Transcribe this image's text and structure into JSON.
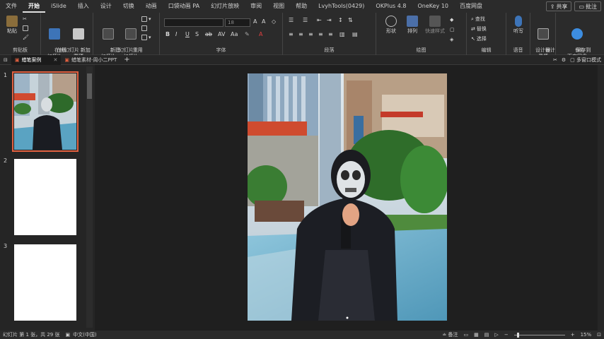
{
  "menu": {
    "tabs": [
      "文件",
      "开始",
      "iSlide",
      "插入",
      "设计",
      "切换",
      "动画",
      "口袋动画 PA",
      "幻灯片放映",
      "审阅",
      "视图",
      "帮助",
      "LvyhTools(0429)",
      "OKPlus 4.8",
      "OneKey 10",
      "百度网盘"
    ],
    "share_label": "共享",
    "comment_label": "批注"
  },
  "ribbon": {
    "clipboard": {
      "paste": "粘贴",
      "group": "剪贴板"
    },
    "online_slides": {
      "btn1": "在线\n幻灯片",
      "btn2": "新加\n载项",
      "group": "在线幻灯片"
    },
    "slides": {
      "new_slide": "新建\n幻灯片",
      "reuse_slide": "重用\n幻灯片",
      "group": "幻灯片"
    },
    "font": {
      "font_size": "18",
      "group": "字体"
    },
    "paragraph": {
      "group": "段落"
    },
    "drawing": {
      "shape": "形状",
      "arrange": "排列",
      "quick_style": "快速样式",
      "group": "绘图"
    },
    "editing": {
      "find": "查找",
      "replace": "替换",
      "select": "选择",
      "group": "编辑"
    },
    "voice": {
      "dictate": "听写",
      "group": "语音"
    },
    "designer": {
      "ideas": "设计\n灵感",
      "group": "设计器"
    },
    "save": {
      "baidu": "保存到\n百度网盘",
      "group": "保存"
    }
  },
  "docbar": {
    "tab1": "蜡笔案例",
    "tab2": "蜡笔素材-周小二PPT",
    "add": "+",
    "multiwindow": "多窗口模式"
  },
  "thumbnails": [
    {
      "number": "1"
    },
    {
      "number": "2"
    },
    {
      "number": "3"
    }
  ],
  "status": {
    "slide_info": "幻灯片 第 1 张，共 29 张",
    "language": "中文(中国)",
    "notes": "备注",
    "zoom": "15%"
  },
  "colors": {
    "accent_selection": "#e06040",
    "background": "#1f1f1f",
    "ribbon": "#2b2b2b"
  }
}
